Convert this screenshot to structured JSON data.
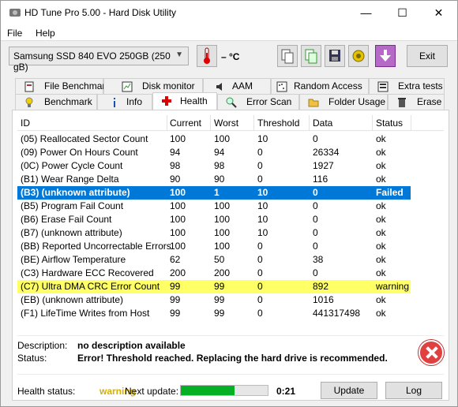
{
  "window": {
    "title": "HD Tune Pro 5.00 - Hard Disk Utility",
    "min": "—",
    "max": "☐",
    "close": "✕"
  },
  "menu": {
    "file": "File",
    "help": "Help"
  },
  "toolbar": {
    "drive": "Samsung SSD 840 EVO 250GB (250 gB)",
    "temperature": "– °C",
    "exit": "Exit"
  },
  "tabs_top": [
    {
      "label": "File Benchmark"
    },
    {
      "label": "Disk monitor"
    },
    {
      "label": "AAM"
    },
    {
      "label": "Random Access"
    },
    {
      "label": "Extra tests"
    }
  ],
  "tabs_bottom": [
    {
      "label": "Benchmark"
    },
    {
      "label": "Info"
    },
    {
      "label": "Health"
    },
    {
      "label": "Error Scan"
    },
    {
      "label": "Folder Usage"
    },
    {
      "label": "Erase"
    }
  ],
  "columns": [
    "ID",
    "Current",
    "Worst",
    "Threshold",
    "Data",
    "Status"
  ],
  "rows": [
    {
      "id": "(05) Reallocated Sector Count",
      "current": "100",
      "worst": "100",
      "threshold": "10",
      "data": "0",
      "status": "ok",
      "state": "normal"
    },
    {
      "id": "(09) Power On Hours Count",
      "current": "94",
      "worst": "94",
      "threshold": "0",
      "data": "26334",
      "status": "ok",
      "state": "normal"
    },
    {
      "id": "(0C) Power Cycle Count",
      "current": "98",
      "worst": "98",
      "threshold": "0",
      "data": "1927",
      "status": "ok",
      "state": "normal"
    },
    {
      "id": "(B1) Wear Range Delta",
      "current": "90",
      "worst": "90",
      "threshold": "0",
      "data": "116",
      "status": "ok",
      "state": "normal"
    },
    {
      "id": "(B3) (unknown attribute)",
      "current": "100",
      "worst": "1",
      "threshold": "10",
      "data": "0",
      "status": "Failed",
      "state": "failed"
    },
    {
      "id": "(B5) Program Fail Count",
      "current": "100",
      "worst": "100",
      "threshold": "10",
      "data": "0",
      "status": "ok",
      "state": "normal"
    },
    {
      "id": "(B6) Erase Fail Count",
      "current": "100",
      "worst": "100",
      "threshold": "10",
      "data": "0",
      "status": "ok",
      "state": "normal"
    },
    {
      "id": "(B7) (unknown attribute)",
      "current": "100",
      "worst": "100",
      "threshold": "10",
      "data": "0",
      "status": "ok",
      "state": "normal"
    },
    {
      "id": "(BB) Reported Uncorrectable Errors",
      "current": "100",
      "worst": "100",
      "threshold": "0",
      "data": "0",
      "status": "ok",
      "state": "normal"
    },
    {
      "id": "(BE) Airflow Temperature",
      "current": "62",
      "worst": "50",
      "threshold": "0",
      "data": "38",
      "status": "ok",
      "state": "normal"
    },
    {
      "id": "(C3) Hardware ECC Recovered",
      "current": "200",
      "worst": "200",
      "threshold": "0",
      "data": "0",
      "status": "ok",
      "state": "normal"
    },
    {
      "id": "(C7) Ultra DMA CRC Error Count",
      "current": "99",
      "worst": "99",
      "threshold": "0",
      "data": "892",
      "status": "warning",
      "state": "warning"
    },
    {
      "id": "(EB) (unknown attribute)",
      "current": "99",
      "worst": "99",
      "threshold": "0",
      "data": "1016",
      "status": "ok",
      "state": "normal"
    },
    {
      "id": "(F1) LifeTime Writes from Host",
      "current": "99",
      "worst": "99",
      "threshold": "0",
      "data": "441317498",
      "status": "ok",
      "state": "normal"
    }
  ],
  "details": {
    "description_label": "Description:",
    "description": "no description available",
    "status_label": "Status:",
    "status": "Error! Threshold reached. Replacing the hard drive is recommended."
  },
  "footer": {
    "health_label": "Health status:",
    "health_value": "warning",
    "next_update_label": "Next update:",
    "progress_fraction": 0.62,
    "countdown": "0:21",
    "update": "Update",
    "log": "Log"
  },
  "colors": {
    "selected_row": "#0078d7",
    "warning_row": "#ffff66",
    "health_warning": "#d4b000",
    "progress": "#06b025"
  }
}
